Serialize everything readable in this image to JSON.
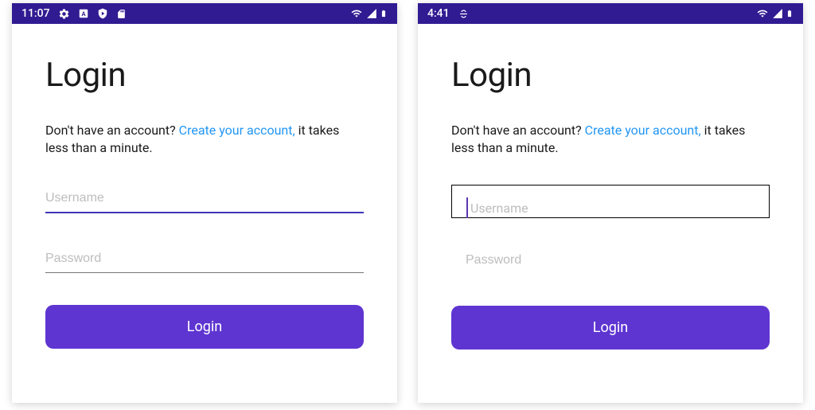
{
  "colors": {
    "statusbar": "#311B92",
    "primary": "#5E35D1",
    "link": "#2196F3"
  },
  "left": {
    "status": {
      "time": "11:07"
    },
    "title": "Login",
    "subtitle_pre": "Don't have an account? ",
    "subtitle_link": "Create your account,",
    "subtitle_post": " it takes less than a minute.",
    "username_placeholder": "Username",
    "password_placeholder": "Password",
    "login_btn": "Login"
  },
  "right": {
    "status": {
      "time": "4:41"
    },
    "title": "Login",
    "subtitle_pre": "Don't have an account? ",
    "subtitle_link": "Create your account,",
    "subtitle_post": " it takes less than a minute.",
    "username_placeholder": "Username",
    "password_placeholder": "Password",
    "login_btn": "Login"
  }
}
